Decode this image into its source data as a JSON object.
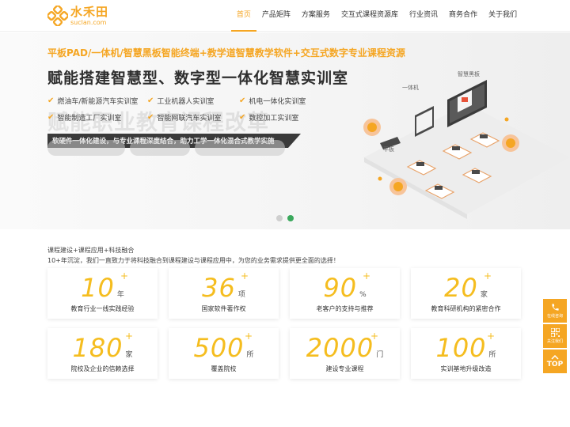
{
  "brand": {
    "name_cn": "水禾田",
    "name_en": "suclan.com",
    "accent": "#f5a623"
  },
  "nav": {
    "items": [
      "首页",
      "产品矩阵",
      "方案服务",
      "交互式课程资源库",
      "行业资讯",
      "商务合作",
      "关于我们"
    ],
    "active_index": 0
  },
  "banner": {
    "subtitle": "平板PAD/一体机/智慧黑板智能终端+教学道智慧教学软件+交互式数字专业课程资源",
    "title": "赋能搭建智慧型、数字型一体化智慧实训室",
    "bg_text": "赋能职业教育课程改革",
    "features": [
      "燃油车/新能源汽车实训室",
      "工业机器人实训室",
      "机电一体化实训室",
      "智能制造工厂实训室",
      "智能网联汽车实训室",
      "数控加工实训室"
    ],
    "strip_text": "软硬件一体化建设，与专业课程深度结合，助力工学一体化混合式教学实施",
    "illustration_labels": [
      "智慧黑板",
      "一体机",
      "平板"
    ],
    "slides_total": 2,
    "active_slide": 2
  },
  "intro": {
    "title": "课程建设+课程应用+科技融合",
    "desc": "10+年沉淀，我们一直致力于将科技融合到课程建设与课程应用中，为您的业务需求提供更全面的选择！"
  },
  "stats": [
    {
      "num": "10",
      "unit": "年",
      "label": "教育行业一线实践经验"
    },
    {
      "num": "36",
      "unit": "项",
      "label": "国家软件著作权"
    },
    {
      "num": "90",
      "unit": "%",
      "label": "老客户的支持与推荐"
    },
    {
      "num": "20",
      "unit": "家",
      "label": "教育科研机构的紧密合作"
    },
    {
      "num": "180",
      "unit": "家",
      "label": "院校及企业的信赖选择"
    },
    {
      "num": "500",
      "unit": "所",
      "label": "覆盖院校"
    },
    {
      "num": "2000",
      "unit": "门",
      "label": "建设专业课程"
    },
    {
      "num": "100",
      "unit": "所",
      "label": "实训基地升级改造"
    }
  ],
  "stat_plus": "+",
  "side_float": {
    "phone_label": "在线咨询",
    "qr_label": "关注我们",
    "top_label": "TOP"
  },
  "icons": [
    "phone-icon",
    "qrcode-icon",
    "arrow-up-icon",
    "check-icon"
  ]
}
